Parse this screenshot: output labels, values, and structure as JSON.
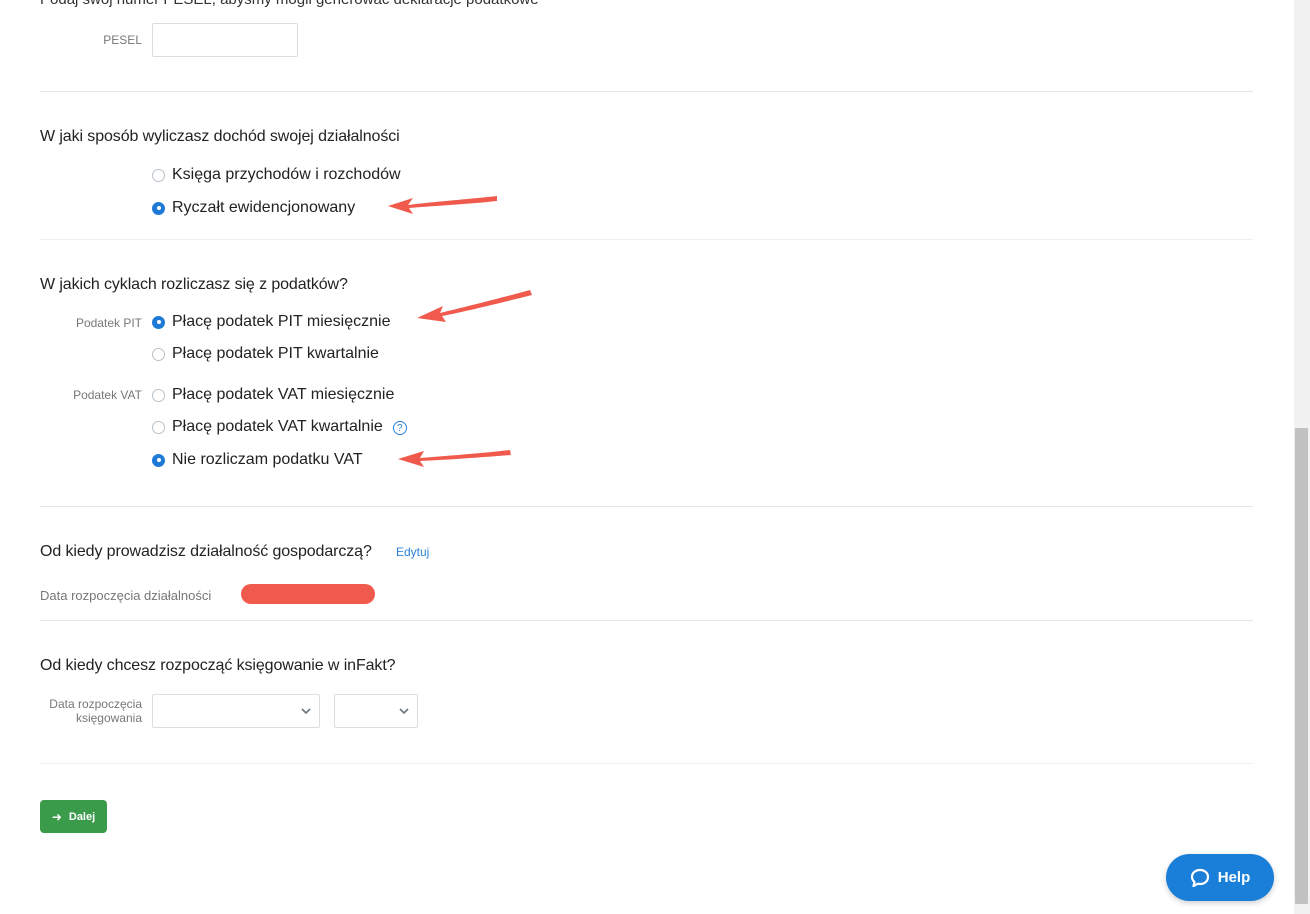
{
  "top_text": "Podaj swój numer PESEL, abyśmy mogli generować deklaracje podatkowe",
  "pesel": {
    "label": "PESEL",
    "value": ""
  },
  "income_section": {
    "title": "W jaki sposób wyliczasz dochód swojej działalności",
    "options": [
      {
        "label": "Księga przychodów i rozchodów",
        "checked": false
      },
      {
        "label": "Ryczałt ewidencjonowany",
        "checked": true
      }
    ]
  },
  "tax_cycle_section": {
    "title": "W jakich cyklach rozliczasz się z podatków?",
    "pit_label": "Podatek PIT",
    "pit_options": [
      {
        "label": "Płacę podatek PIT miesięcznie",
        "checked": true
      },
      {
        "label": "Płacę podatek PIT kwartalnie",
        "checked": false
      }
    ],
    "vat_label": "Podatek VAT",
    "vat_options": [
      {
        "label": "Płacę podatek VAT miesięcznie",
        "checked": false
      },
      {
        "label": "Płacę podatek VAT kwartalnie",
        "checked": false
      },
      {
        "label": "Nie rozliczam podatku VAT",
        "checked": true
      }
    ],
    "help_glyph": "?"
  },
  "business_start_section": {
    "title": "Od kiedy prowadzisz działalność gospodarczą?",
    "edit_label": "Edytuj",
    "date_label": "Data rozpoczęcia działalności"
  },
  "accounting_start_section": {
    "title": "Od kiedy chcesz rozpocząć księgowanie w inFakt?",
    "date_label_line1": "Data rozpoczęcia",
    "date_label_line2": "księgowania",
    "month_value": "",
    "year_value": ""
  },
  "next_button": {
    "label": "Dalej",
    "icon": "arrow-right-icon"
  },
  "help_button": {
    "label": "Help",
    "icon": "chat-bubble-icon"
  },
  "colors": {
    "accent_blue": "#1f7ad6",
    "button_green": "#3a9b4a",
    "annotation_red": "#f05a4d"
  }
}
